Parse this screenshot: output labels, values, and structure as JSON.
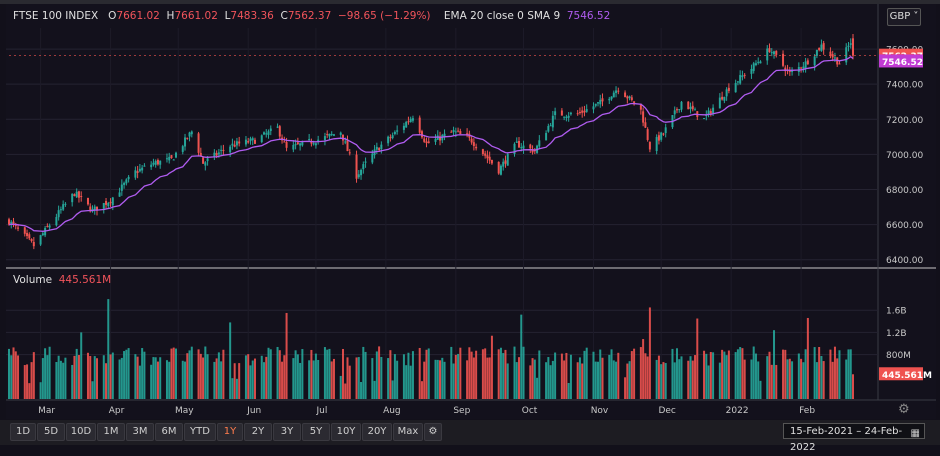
{
  "header": {
    "symbol": "FTSE 100 INDEX",
    "open_label": "O",
    "open": "7661.02",
    "high_label": "H",
    "high": "7661.02",
    "low_label": "L",
    "low": "7483.36",
    "close_label": "C",
    "close": "7562.37",
    "change": "−98.65 (−1.29%)",
    "indicator_label": "EMA 20 close 0 SMA 9",
    "indicator_value": "7546.52"
  },
  "currency": "GBP ˅",
  "volume": {
    "label": "Volume",
    "value": "445.561M"
  },
  "toolbar": {
    "ranges": [
      "1D",
      "5D",
      "10D",
      "1M",
      "3M",
      "6M",
      "YTD",
      "1Y",
      "2Y",
      "3Y",
      "5Y",
      "10Y",
      "20Y",
      "Max"
    ],
    "active": "1Y",
    "settings_icon": "gear-icon",
    "date_range": "15-Feb-2021  –  24-Feb-2022",
    "calendar_icon": "calendar-icon"
  },
  "colors": {
    "up": "#26a69a",
    "down": "#ef5350",
    "ema": "#b05cf0",
    "background": "#13111c"
  },
  "chart_data": [
    {
      "type": "candlestick",
      "title": "FTSE 100 INDEX",
      "x_tick_labels": [
        "Mar",
        "Apr",
        "May",
        "Jun",
        "Jul",
        "Aug",
        "Sep",
        "Oct",
        "Nov",
        "Dec",
        "2022",
        "Feb"
      ],
      "y_tick_labels": [
        "6400.00",
        "6600.00",
        "6800.00",
        "7000.00",
        "7200.00",
        "7400.00",
        "7600.00"
      ],
      "ylim": [
        6370,
        7720
      ],
      "date_range": [
        "2021-02-15",
        "2022-02-24"
      ],
      "price_anchors": [
        [
          "2021-02-15",
          6620
        ],
        [
          "2021-02-26",
          6480
        ],
        [
          "2021-03-08",
          6650
        ],
        [
          "2021-03-16",
          6780
        ],
        [
          "2021-03-24",
          6680
        ],
        [
          "2021-04-01",
          6740
        ],
        [
          "2021-04-12",
          6900
        ],
        [
          "2021-04-20",
          6950
        ],
        [
          "2021-04-28",
          6970
        ],
        [
          "2021-05-07",
          7130
        ],
        [
          "2021-05-12",
          6950
        ],
        [
          "2021-05-24",
          7050
        ],
        [
          "2021-06-04",
          7080
        ],
        [
          "2021-06-14",
          7150
        ],
        [
          "2021-06-18",
          7030
        ],
        [
          "2021-06-28",
          7070
        ],
        [
          "2021-07-06",
          7100
        ],
        [
          "2021-07-12",
          7130
        ],
        [
          "2021-07-19",
          6880
        ],
        [
          "2021-07-28",
          7030
        ],
        [
          "2021-08-05",
          7120
        ],
        [
          "2021-08-13",
          7220
        ],
        [
          "2021-08-19",
          7060
        ],
        [
          "2021-08-31",
          7130
        ],
        [
          "2021-09-08",
          7080
        ],
        [
          "2021-09-20",
          6910
        ],
        [
          "2021-09-28",
          7060
        ],
        [
          "2021-10-06",
          7020
        ],
        [
          "2021-10-15",
          7230
        ],
        [
          "2021-10-25",
          7230
        ],
        [
          "2021-11-05",
          7300
        ],
        [
          "2021-11-12",
          7380
        ],
        [
          "2021-11-22",
          7250
        ],
        [
          "2021-11-26",
          7040
        ],
        [
          "2021-12-02",
          7120
        ],
        [
          "2021-12-10",
          7300
        ],
        [
          "2021-12-20",
          7200
        ],
        [
          "2021-12-31",
          7380
        ],
        [
          "2022-01-10",
          7490
        ],
        [
          "2022-01-18",
          7600
        ],
        [
          "2022-01-27",
          7460
        ],
        [
          "2022-02-03",
          7520
        ],
        [
          "2022-02-10",
          7620
        ],
        [
          "2022-02-18",
          7520
        ],
        [
          "2022-02-23",
          7640
        ],
        [
          "2022-02-24",
          7562.37
        ]
      ],
      "last_close": 7562.37,
      "ema_last": 7546.52,
      "series": [
        {
          "name": "EMA 20 close 0 SMA 9"
        }
      ]
    },
    {
      "type": "bar",
      "title": "Volume",
      "y_tick_labels": [
        "800M",
        "1.2B",
        "1.6B"
      ],
      "ylim": [
        0,
        2000
      ],
      "units": "millions",
      "typical_range": [
        600,
        950
      ],
      "spikes": [
        [
          "2021-03-19",
          1200
        ],
        [
          "2021-03-31",
          1800
        ],
        [
          "2021-05-24",
          1380
        ],
        [
          "2021-06-18",
          1550
        ],
        [
          "2021-09-17",
          1140
        ],
        [
          "2021-09-30",
          1520
        ],
        [
          "2021-11-23",
          1080
        ],
        [
          "2021-11-26",
          1650
        ],
        [
          "2021-12-17",
          1450
        ],
        [
          "2022-01-20",
          1240
        ],
        [
          "2022-02-04",
          1460
        ],
        [
          "2022-02-24",
          445.561
        ]
      ],
      "last_value": 445.561
    }
  ]
}
